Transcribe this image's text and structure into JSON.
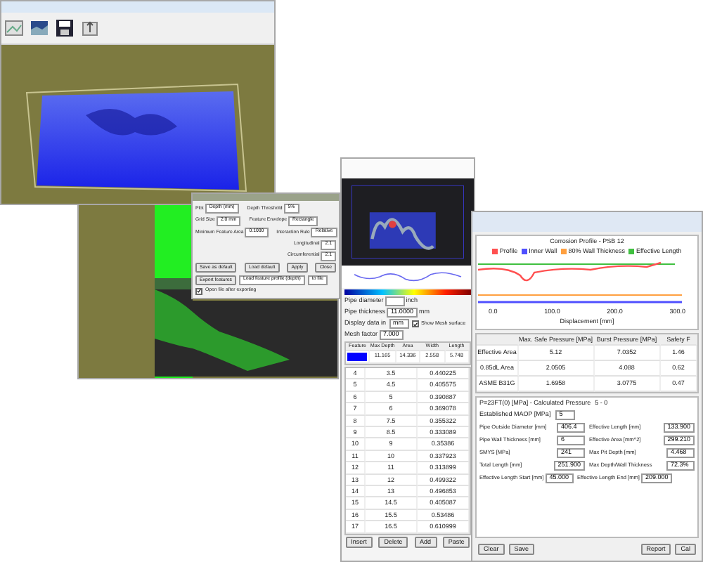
{
  "feature_dialog": {
    "fields": [
      {
        "label": "Plot",
        "value": "Depth (mm)"
      },
      {
        "label": "Depth Threshold",
        "value": "5%"
      },
      {
        "label": "Grid Size",
        "value": "2.0 mm"
      },
      {
        "label": "Feature Envelope",
        "value": "Rectangle"
      },
      {
        "label": "Minimum Feature Area",
        "value": "0.1000"
      },
      {
        "label": "Interaction Rule",
        "value": "Relative"
      },
      {
        "label": "Longitudinal",
        "value": "2.1"
      },
      {
        "label": "Circumferential",
        "value": "2.1"
      }
    ],
    "buttons": [
      "Save as default",
      "Load default",
      "Apply",
      "Close"
    ],
    "export_button": "Export features",
    "export_choice": "Load feature profile (depth)",
    "export_target": "to file",
    "open_after": {
      "label": "Open file after exporting",
      "checked": true
    }
  },
  "scan_window": {
    "pipe_fields": [
      {
        "label": "Pipe diameter",
        "unit": "inch"
      },
      {
        "label": "Pipe thickness",
        "value": "11.0000",
        "unit": "mm"
      }
    ],
    "display_label": "Display data in",
    "display_unit": "mm",
    "show_mesh": {
      "label": "Show Mesh surface",
      "checked": true
    },
    "mesh_label": "Mesh factor",
    "mesh_value": "7.000",
    "feature_columns": [
      "Feature",
      "Max Depth",
      "Area",
      "Width",
      "Length"
    ],
    "feature_rows": [
      {
        "color": "#0000ff",
        "cells": [
          "11.165",
          "14.336",
          "2.558",
          "5.748"
        ]
      }
    ],
    "point_rows": [
      [
        "4",
        "3.5",
        "0.440225"
      ],
      [
        "5",
        "4.5",
        "0.405575"
      ],
      [
        "6",
        "5",
        "0.390887"
      ],
      [
        "7",
        "6",
        "0.369078"
      ],
      [
        "8",
        "7.5",
        "0.355322"
      ],
      [
        "9",
        "8.5",
        "0.333089"
      ],
      [
        "10",
        "9",
        "0.35386"
      ],
      [
        "11",
        "10",
        "0.337923"
      ],
      [
        "12",
        "11",
        "0.313899"
      ],
      [
        "13",
        "12",
        "0.499322"
      ],
      [
        "14",
        "13",
        "0.496853"
      ],
      [
        "15",
        "14.5",
        "0.405087"
      ],
      [
        "16",
        "15.5",
        "0.53486"
      ],
      [
        "17",
        "16.5",
        "0.610999"
      ]
    ],
    "buttons": [
      "Insert",
      "Delete",
      "Add",
      "Paste"
    ]
  },
  "report_window": {
    "chart_title": "Corrosion Profile - PSB 12",
    "legend": [
      {
        "label": "Profile",
        "color": "#ff5050"
      },
      {
        "label": "Inner Wall",
        "color": "#5050ff"
      },
      {
        "label": "80% Wall Thickness",
        "color": "#ffa040"
      },
      {
        "label": "Effective Length",
        "color": "#40c040"
      }
    ],
    "x_ticks": [
      "0.0",
      "100.0",
      "200.0",
      "300.0"
    ],
    "xlabel": "Displacement [mm]",
    "pressure_columns": [
      "Max. Safe Pressure [MPa]",
      "Burst Pressure [MPa]",
      "Safety F"
    ],
    "pressure_rows": [
      {
        "label": "Effective Area",
        "cells": [
          "5.12",
          "7.0352",
          "1.46"
        ]
      },
      {
        "label": "0.85dL Area",
        "cells": [
          "2.0505",
          "4.088",
          "0.62"
        ]
      },
      {
        "label": "ASME B31G",
        "cells": [
          "1.6958",
          "3.0775",
          "0.47"
        ]
      }
    ],
    "calc_label": "P=23FT(0) [MPa] - Calculated Pressure",
    "calc_value": "5 - 0",
    "maop_label": "Established MAOP [MPa]",
    "maop_value": "5",
    "fields": [
      {
        "label": "Pipe Outside Diameter [mm]",
        "value": "406.4"
      },
      {
        "label": "Effective Length [mm]",
        "value": "133.900"
      },
      {
        "label": "Pipe Wall Thickness [mm]",
        "value": "6"
      },
      {
        "label": "Effective Area [mm^2]",
        "value": "299.210"
      },
      {
        "label": "SMYS [MPa]",
        "value": "241"
      },
      {
        "label": "Max Pit Depth [mm]",
        "value": "4.468"
      },
      {
        "label": "Total Length [mm]",
        "value": "251.900"
      },
      {
        "label": "Max Depth/Wall Thickness",
        "value": "72.3%"
      }
    ],
    "range_fields": [
      {
        "label": "Effective Length Start [mm]",
        "value": "45.000"
      },
      {
        "label": "Effective Length End [mm]",
        "value": "209.000"
      }
    ],
    "left_buttons": [
      "Clear",
      "Save"
    ],
    "right_buttons": [
      "Report",
      "Cal"
    ]
  }
}
